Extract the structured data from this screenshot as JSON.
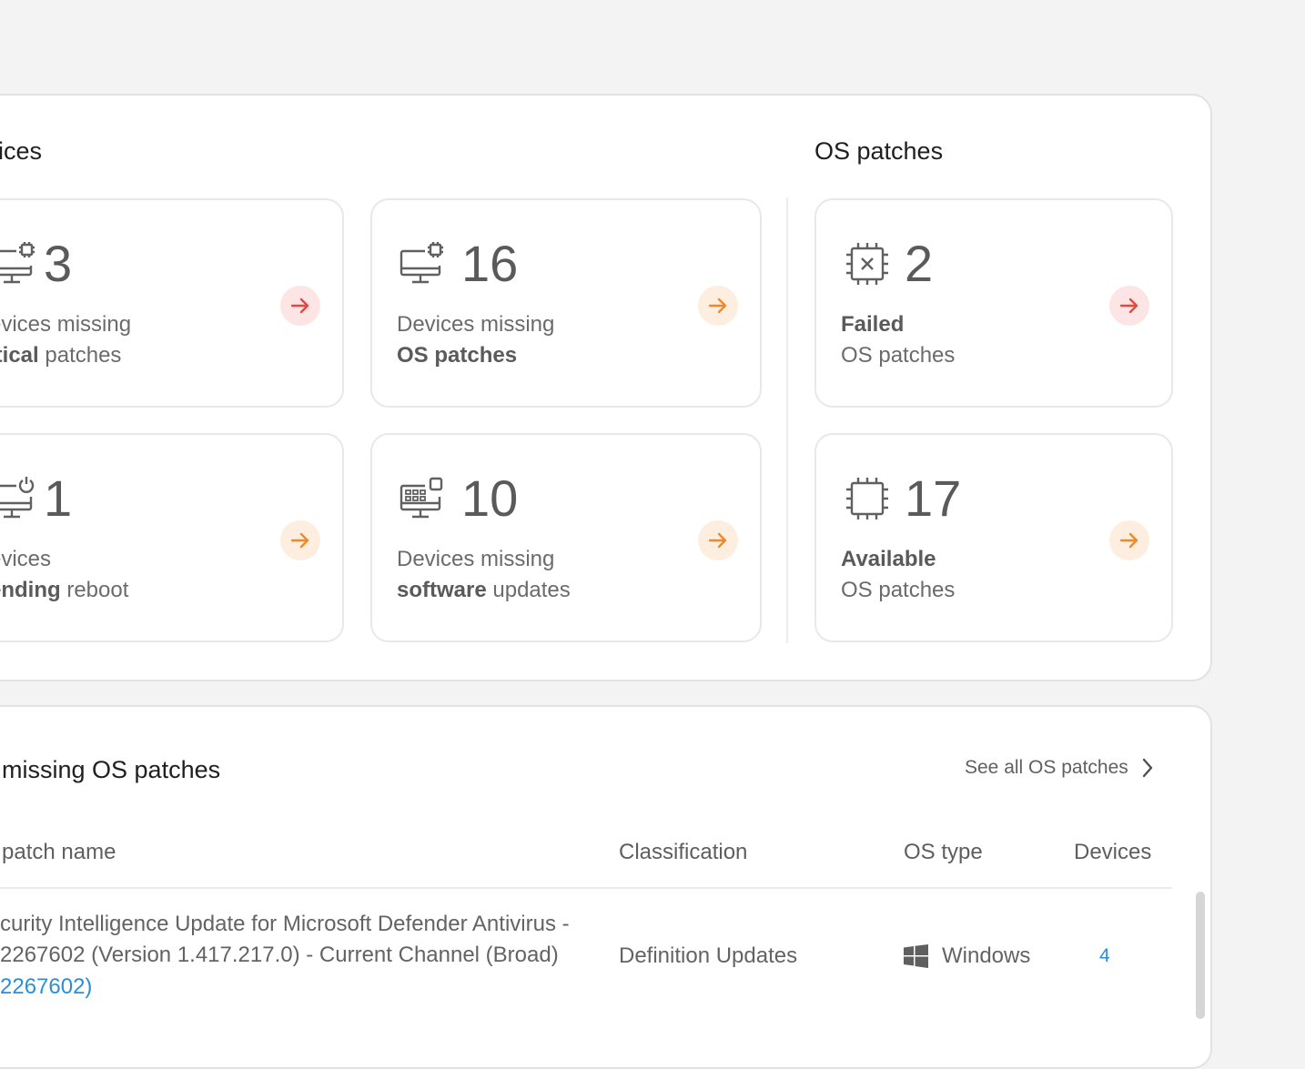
{
  "devices_section": {
    "title": "ices"
  },
  "os_section": {
    "title": "OS patches"
  },
  "cards": {
    "critical": {
      "count": "3",
      "line1": "evices missing",
      "line2_bold": "itical",
      "line2_rest": " patches"
    },
    "os_missing": {
      "count": "16",
      "line1": "Devices missing",
      "line2_bold": "OS patches",
      "line2_rest": ""
    },
    "failed": {
      "count": "2",
      "line1_bold": "Failed",
      "line2": "OS patches"
    },
    "reboot": {
      "count": "1",
      "line1": "evices",
      "line2_bold": "ending",
      "line2_rest": " reboot"
    },
    "software": {
      "count": "10",
      "line1": "Devices missing",
      "line2_bold": "software",
      "line2_rest": " updates"
    },
    "available": {
      "count": "17",
      "line1_bold": "Available",
      "line2": "OS patches"
    }
  },
  "table_section": {
    "title": "missing OS patches",
    "see_all": "See all OS patches",
    "headers": {
      "name": "patch name",
      "classification": "Classification",
      "os_type": "OS type",
      "devices": "Devices"
    },
    "rows": [
      {
        "name_line1": "curity Intelligence Update for Microsoft Defender Antivirus -",
        "name_line2": "2267602 (Version 1.417.217.0) - Current Channel (Broad)",
        "name_link": "2267602)",
        "classification": "Definition Updates",
        "os_type": "Windows",
        "devices": "4"
      }
    ]
  },
  "colors": {
    "red_accent": "#e04a43",
    "orange_accent": "#ee8a2d",
    "link": "#2b8fd6"
  },
  "icons": {
    "critical": "monitor-chip-icon",
    "os_missing": "monitor-chip-icon",
    "failed": "chip-x-icon",
    "reboot": "monitor-power-icon",
    "software": "monitor-apps-icon",
    "available": "chip-icon",
    "arrows": "arrow-right-icon",
    "see_all": "chevron-right-icon",
    "windows": "windows-logo-icon"
  }
}
